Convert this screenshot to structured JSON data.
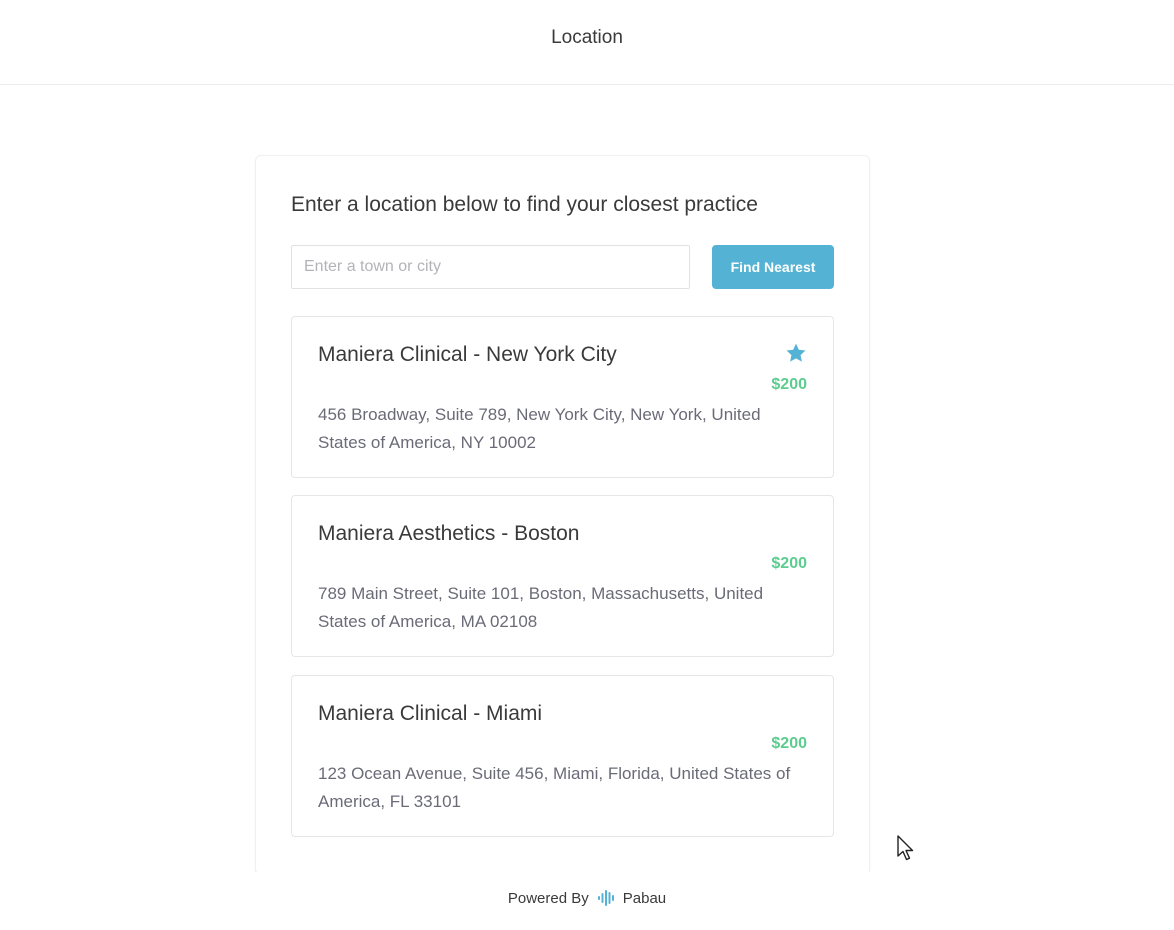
{
  "header": {
    "title": "Location"
  },
  "search": {
    "heading": "Enter a location below to find your closest practice",
    "placeholder": "Enter a town or city",
    "value": "",
    "button_label": "Find Nearest"
  },
  "locations": [
    {
      "name": "Maniera Clinical - New York City",
      "price": "$200",
      "address": "456 Broadway, Suite 789, New York City, New York, United States of America, NY 10002",
      "starred": true
    },
    {
      "name": "Maniera Aesthetics - Boston",
      "price": "$200",
      "address": "789 Main Street, Suite 101, Boston, Massachusetts, United States of America, MA 02108",
      "starred": false
    },
    {
      "name": "Maniera Clinical - Miami",
      "price": "$200",
      "address": "123 Ocean Avenue, Suite 456, Miami, Florida, United States of America, FL 33101",
      "starred": false
    }
  ],
  "footer": {
    "powered_by": "Powered By",
    "brand": "Pabau",
    "logo_icon": "pabau-logo-icon"
  },
  "colors": {
    "accent": "#54b3d4",
    "price": "#5ccc8f",
    "star": "#54b3d4"
  },
  "icons": {
    "favorite": "star-icon"
  }
}
